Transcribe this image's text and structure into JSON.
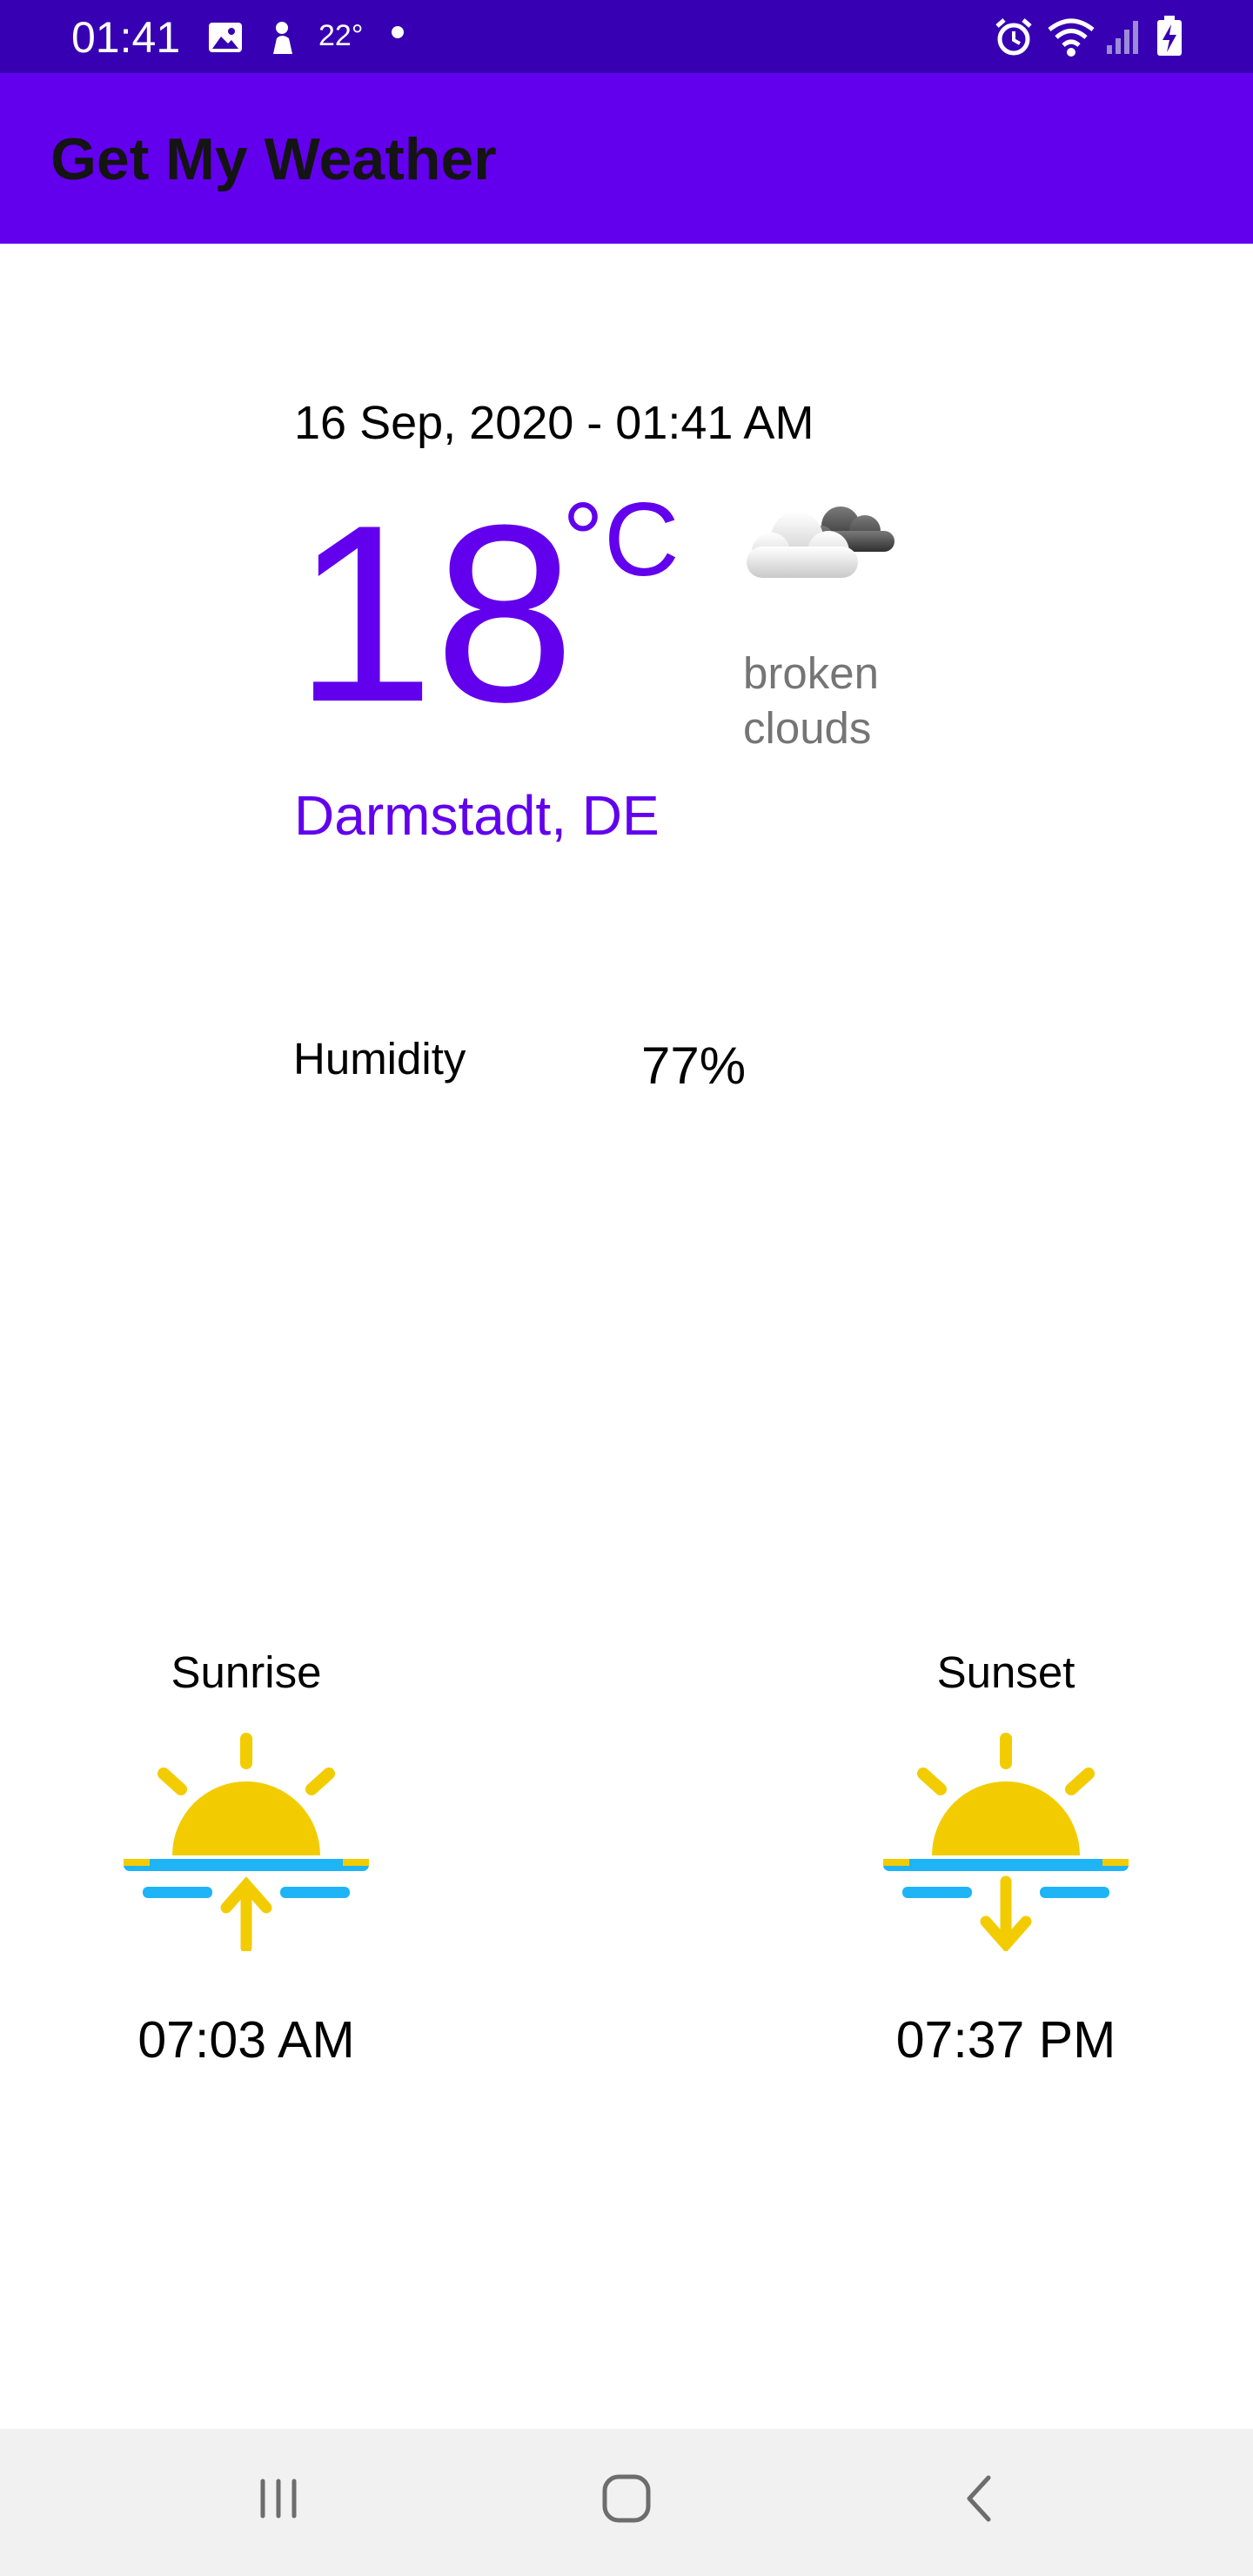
{
  "status_bar": {
    "time": "01:41",
    "temperature": "22°",
    "icons": [
      "image-icon",
      "weather-notification-icon",
      "alarm-icon",
      "wifi-icon",
      "signal-icon",
      "battery-charging-icon"
    ]
  },
  "app_bar": {
    "title": "Get My Weather",
    "color": "#6200ee"
  },
  "weather": {
    "datetime": "16 Sep, 2020 - 01:41 AM",
    "temperature": "18",
    "unit": "°C",
    "condition_line1": "broken",
    "condition_line2": "clouds",
    "condition_icon": "broken-clouds-icon",
    "location": "Darmstadt, DE",
    "accent_color": "#6200ee"
  },
  "humidity": {
    "label": "Humidity",
    "value": "77%"
  },
  "sun": {
    "sunrise_label": "Sunrise",
    "sunrise_time": "07:03 AM",
    "sunrise_icon": "sunrise-icon",
    "sunset_label": "Sunset",
    "sunset_time": "07:37 PM",
    "sunset_icon": "sunset-icon",
    "sun_color": "#f2cc00",
    "water_color": "#1eb4f5"
  },
  "nav_bar": {
    "buttons": [
      "recent-apps-icon",
      "home-icon",
      "back-icon"
    ]
  }
}
